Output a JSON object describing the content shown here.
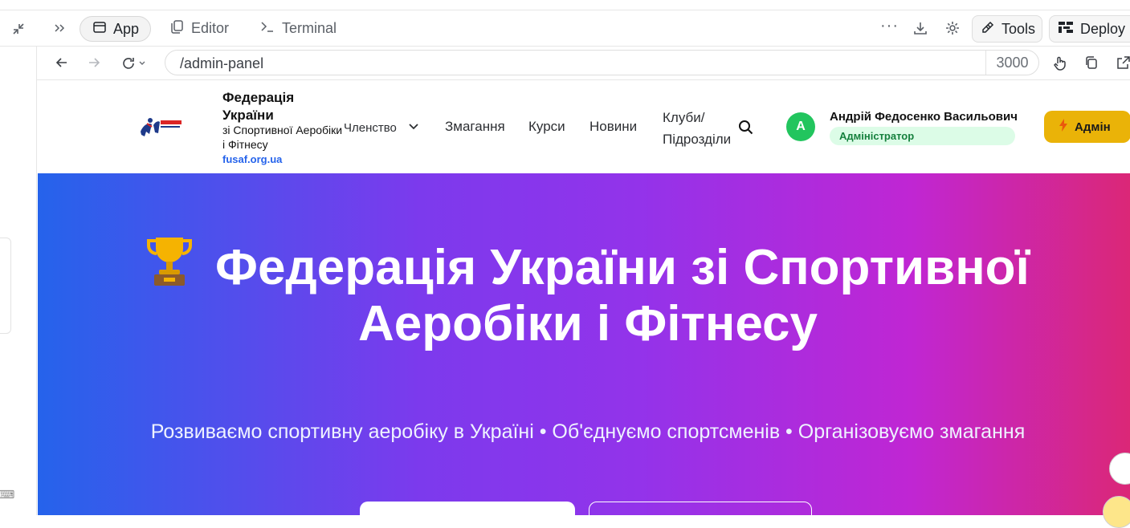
{
  "topbar": {
    "tabs": [
      {
        "label": "App",
        "icon": "window-icon"
      },
      {
        "label": "Editor",
        "icon": "files-icon"
      },
      {
        "label": "Terminal",
        "icon": "terminal-icon"
      }
    ],
    "tools_label": "Tools",
    "deploy_label": "Deploy"
  },
  "browser": {
    "url": "/admin-panel",
    "port": "3000"
  },
  "site": {
    "brand_title": "Федерація України",
    "brand_subtitle": "зі Спортивної Аеробіки і Фітнесу",
    "brand_site": "fusaf.org.ua",
    "nav": {
      "membership": "Членство",
      "competitions": "Змагання",
      "courses": "Курси",
      "news": "Новини",
      "clubs": "Клуби/ Підрозділи"
    },
    "user": {
      "initial": "А",
      "name": "Андрій Федосенко Васильович",
      "role": "Адміністратор"
    },
    "admin_button": "Адмін",
    "hero": {
      "emoji": "🏆",
      "title": "Федерація України зі Спортивної Аеробіки і Фітнесу",
      "subtitle": "Розвиваємо спортивну аеробіку в Україні • Об'єднуємо спортсменів • Організовуємо змагання"
    }
  },
  "colors": {
    "accent_admin": "#eab308",
    "avatar_green": "#22c55e",
    "gradient_start": "#2563eb",
    "gradient_end": "#db2777"
  }
}
